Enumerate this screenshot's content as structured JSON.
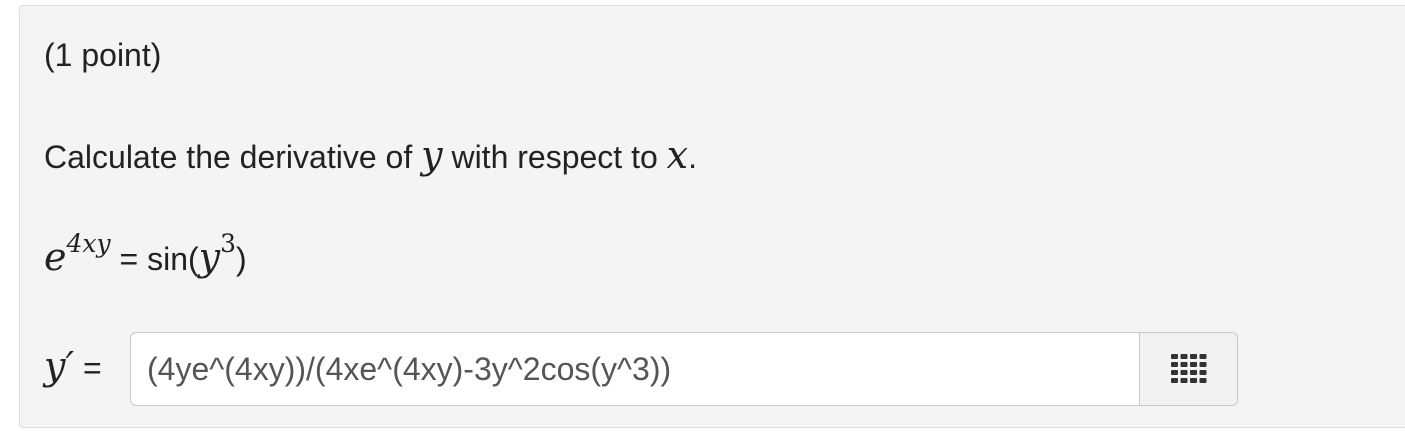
{
  "problem": {
    "points": "(1 point)",
    "question_prefix": "Calculate the derivative of ",
    "var_y": "y",
    "question_middle": " with respect to ",
    "var_x": "x",
    "question_suffix": "."
  },
  "equation": {
    "base": "e",
    "exponent": "4xy",
    "equals": " = ",
    "rhs_prefix": "sin(",
    "rhs_var": "y",
    "rhs_power": "3",
    "rhs_suffix": ")"
  },
  "answer": {
    "label_var": "y′",
    "equals": " = ",
    "value": "(4ye^(4xy))/(4xe^(4xy)-3y^2cos(y^3))",
    "keyboard_icon": "grid-keypad-icon"
  },
  "colors": {
    "panel_background": "#f4f4f4",
    "input_background": "#ffffff",
    "icon_color": "#333333"
  }
}
